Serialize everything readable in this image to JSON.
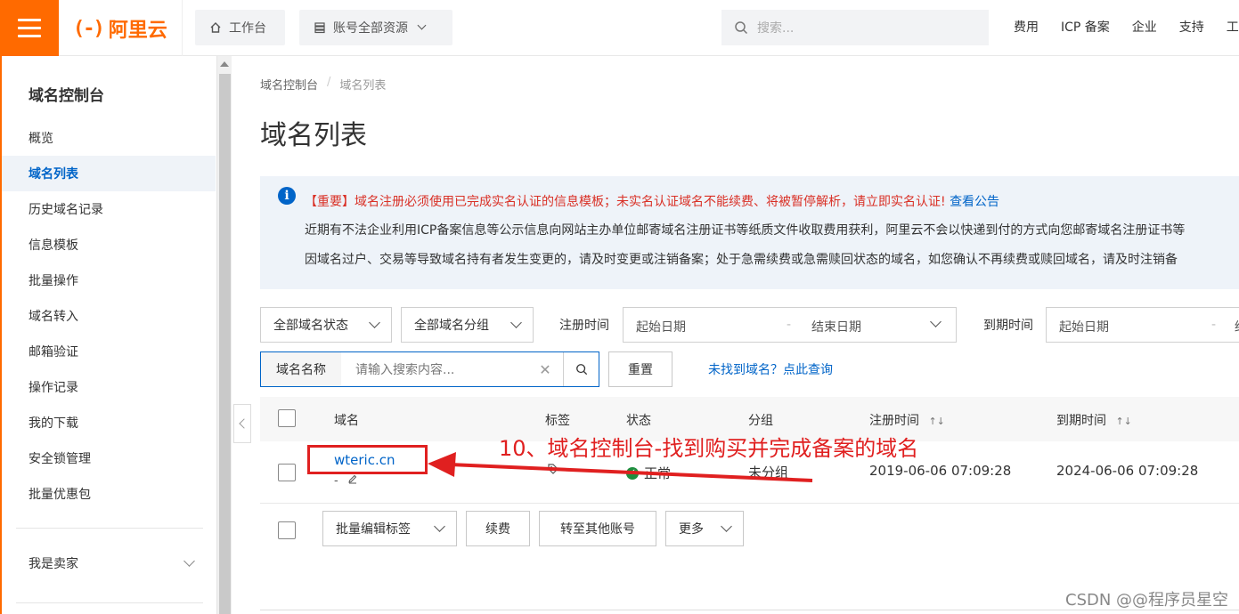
{
  "topbar": {
    "logo_text": "阿里云",
    "workbench": "工作台",
    "resources": "账号全部资源",
    "search_placeholder": "搜索...",
    "links": [
      "费用",
      "ICP 备案",
      "企业",
      "支持",
      "工"
    ]
  },
  "sidebar": {
    "title": "域名控制台",
    "items": [
      {
        "label": "概览"
      },
      {
        "label": "域名列表"
      },
      {
        "label": "历史域名记录"
      },
      {
        "label": "信息模板"
      },
      {
        "label": "批量操作"
      },
      {
        "label": "域名转入"
      },
      {
        "label": "邮箱验证"
      },
      {
        "label": "操作记录"
      },
      {
        "label": "我的下载"
      },
      {
        "label": "安全锁管理"
      },
      {
        "label": "批量优惠包"
      }
    ],
    "active_index": 1,
    "seller": "我是卖家"
  },
  "breadcrumb": [
    "域名控制台",
    "域名列表"
  ],
  "breadcrumb_sep": "/",
  "page_title": "域名列表",
  "notice": {
    "line1_red": "【重要】域名注册必须使用已完成实名认证的信息模板；未实名认证域名不能续费、将被暂停解析，请立即实名认证!",
    "line1_link": "查看公告",
    "line2": "近期有不法企业利用ICP备案信息等公示信息向网站主办单位邮寄域名注册证书等纸质文件收取费用获利，阿里云不会以快递到付的方式向您邮寄域名注册证书等",
    "line3": "因域名过户、交易等导致域名持有者发生变更的，请及时变更或注销备案；处于急需续费或急需赎回状态的域名，如您确认不再续费或赎回域名，请及时注销备"
  },
  "filters": {
    "status": "全部域名状态",
    "group": "全部域名分组",
    "reg_time_label": "注册时间",
    "reg_start": "起始日期",
    "range_sep": "-",
    "reg_end": "结束日期",
    "exp_time_label": "到期时间",
    "exp_start": "起始日期",
    "exp_end": "结"
  },
  "search": {
    "prefix": "域名名称",
    "placeholder": "请输入搜索内容...",
    "reset": "重置",
    "not_found": "未找到域名？点此查询"
  },
  "table": {
    "headers": {
      "domain": "域名",
      "tag": "标签",
      "status": "状态",
      "group": "分组",
      "reg_time": "注册时间",
      "exp_time": "到期时间",
      "sort_icon": "↑↓"
    },
    "rows": [
      {
        "domain": "wteric.cn",
        "remark": "-",
        "status": "正常",
        "group": "未分组",
        "reg_time": "2019-06-06 07:09:28",
        "exp_time": "2024-06-06 07:09:28"
      }
    ]
  },
  "batch": {
    "edit_tags": "批量编辑标签",
    "renew": "续费",
    "transfer": "转至其他账号",
    "more": "更多"
  },
  "annotation": {
    "text": "10、域名控制台-找到购买并完成备案的域名",
    "color": "#e02020"
  },
  "watermark": "CSDN @@程序员星空",
  "colors": {
    "brand": "#ff6a00",
    "link": "#0064c8",
    "alert_red": "#d93026"
  }
}
